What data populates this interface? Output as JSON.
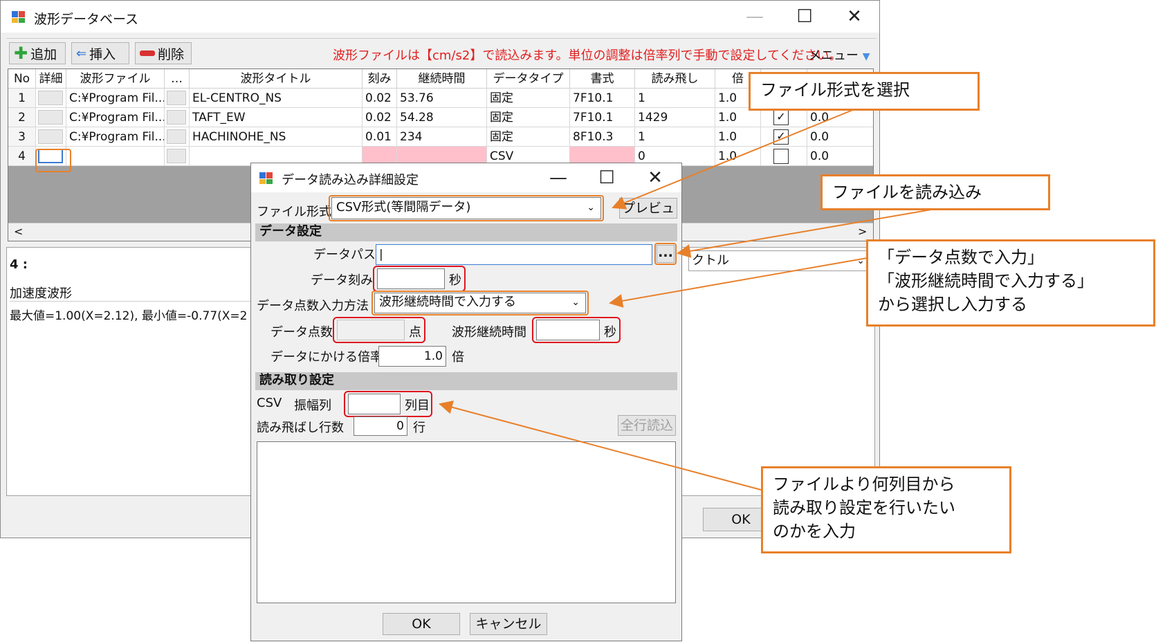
{
  "main_window": {
    "title": "波形データベース",
    "controls": {
      "minimize": "—",
      "maximize": "☐",
      "close": "✕"
    },
    "toolbar": {
      "add": "追加",
      "insert": "挿入",
      "delete": "削除",
      "menu": "メニュー"
    },
    "notice": "波形ファイルは【cm/s2】で読込みます。単位の調整は倍率列で手動で設定してください。",
    "columns": [
      "No",
      "詳細",
      "波形ファイル",
      "…",
      "波形タイトル",
      "刻み",
      "継続時間",
      "データタイプ",
      "書式",
      "読み飛し",
      "倍"
    ],
    "rows": [
      {
        "no": "1",
        "file": "C:¥Program Fil...",
        "title": "EL-CENTRO_NS",
        "step": "0.02",
        "duration": "53.76",
        "type": "固定",
        "format": "7F10.1",
        "skip": "1",
        "mult": "1.0",
        "checked": false,
        "extra": ""
      },
      {
        "no": "2",
        "file": "C:¥Program Fil...",
        "title": "TAFT_EW",
        "step": "0.02",
        "duration": "54.28",
        "type": "固定",
        "format": "7F10.1",
        "skip": "1429",
        "mult": "1.0",
        "checked": true,
        "extra": "0.0"
      },
      {
        "no": "3",
        "file": "C:¥Program Fil...",
        "title": "HACHINOHE_NS",
        "step": "0.01",
        "duration": "234",
        "type": "固定",
        "format": "8F10.3",
        "skip": "1",
        "mult": "1.0",
        "checked": true,
        "extra": "0.0"
      },
      {
        "no": "4",
        "file": "",
        "title": "",
        "step": "",
        "duration": "",
        "type": "CSV",
        "format": "",
        "skip": "0",
        "mult": "1.0",
        "checked": false,
        "extra": "0.0"
      }
    ],
    "panel_label": "4 :",
    "waveform_label": "加速度波形",
    "stats": "最大値=1.00(X=2.12), 最小値=-0.77(X=2",
    "right_combo_fragment": "クトル",
    "ok": "OK"
  },
  "dialog": {
    "title": "データ読み込み詳細設定",
    "controls": {
      "minimize": "—",
      "maximize": "☐",
      "close": "✕"
    },
    "file_format_label": "ファイル形式",
    "file_format_value": "CSV形式(等間隔データ)",
    "preview": "プレビュー",
    "data_section": "データ設定",
    "data_path_label": "データパス",
    "data_path_value": "|",
    "browse": "...",
    "step_label": "データ刻み",
    "step_value": "",
    "sec_unit": "秒",
    "count_method_label": "データ点数入力方法",
    "count_method_value": "波形継続時間で入力する",
    "count_label": "データ点数",
    "count_unit": "点",
    "duration_label": "波形継続時間",
    "duration_value": "",
    "multiplier_label": "データにかける倍率",
    "multiplier_value": "1.0",
    "multiplier_unit": "倍",
    "read_section": "読み取り設定",
    "csv_label": "CSV",
    "amp_col_label": "振幅列",
    "amp_col_value": "",
    "col_unit": "列目",
    "skip_rows_label": "読み飛ばし行数",
    "skip_rows_value": "0",
    "row_unit": "行",
    "read_all": "全行読込",
    "ok": "OK",
    "cancel": "キャンセル"
  },
  "callouts": {
    "file_format": "ファイル形式を選択",
    "load_file": "ファイルを読み込み",
    "count_method": [
      "「データ点数で入力」",
      "「波形継続時間で入力する」",
      "から選択し入力する"
    ],
    "column": [
      "ファイルより何列目から",
      "読み取り設定を行いたい",
      "のかを入力"
    ]
  },
  "colors": {
    "annotation_orange": "#e8802a",
    "highlight_red": "#e0141e",
    "notice_red": "#e02020",
    "invalid_pink": "#ffc0cb"
  }
}
